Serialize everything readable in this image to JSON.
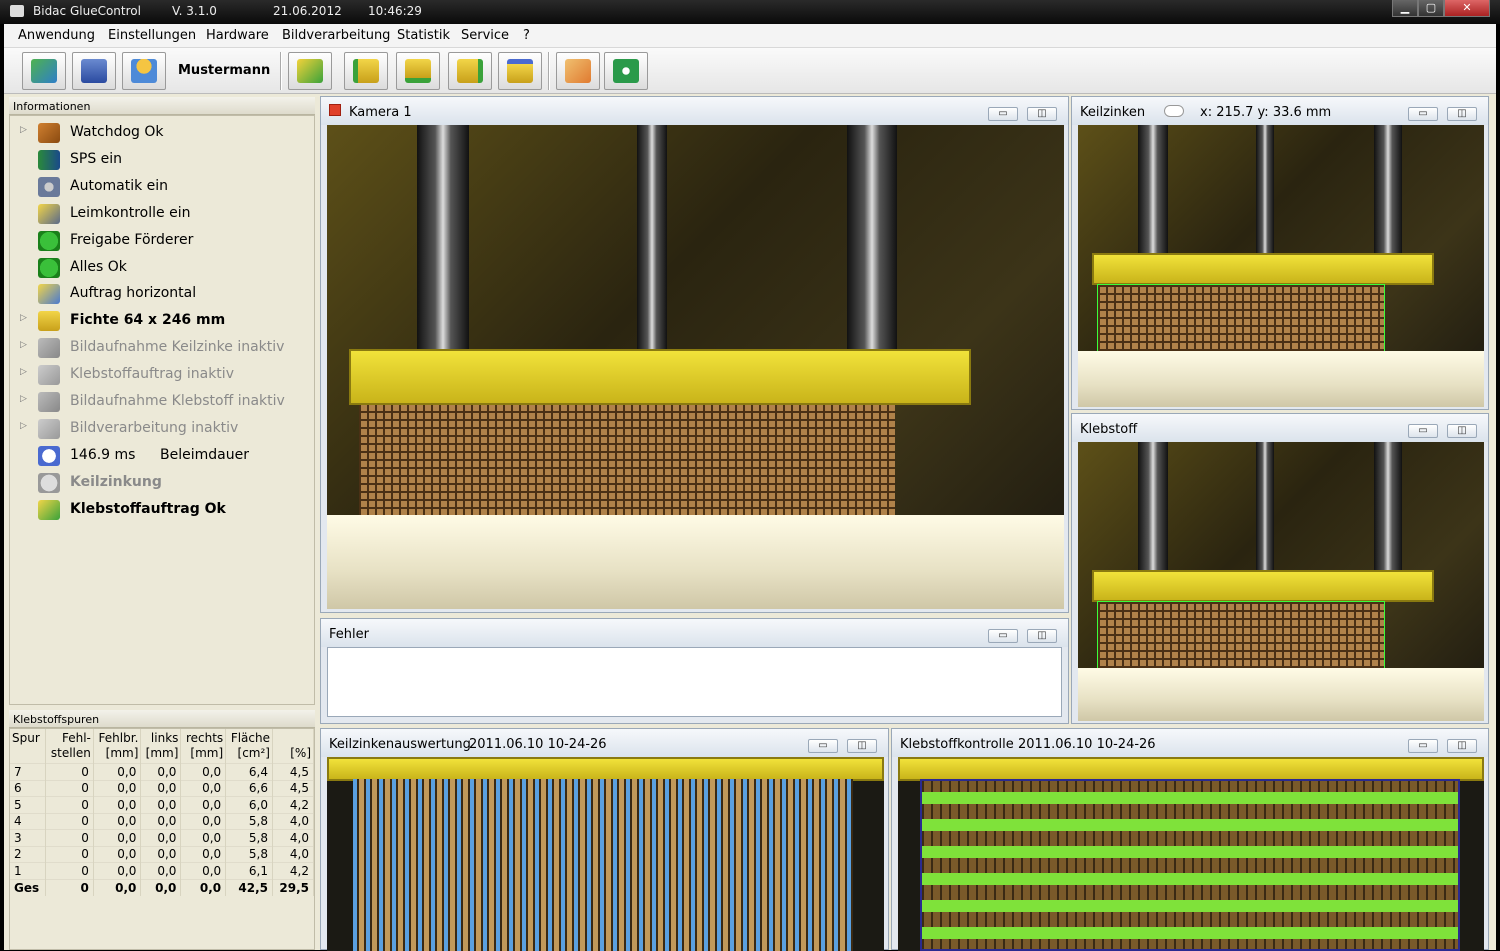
{
  "titlebar": {
    "app": "Bidac GlueControl",
    "version": "V. 3.1.0",
    "date": "21.06.2012",
    "time": "10:46:29"
  },
  "menu": [
    "Anwendung",
    "Einstellungen",
    "Hardware",
    "Bildverarbeitung",
    "Statistik",
    "Service",
    "?"
  ],
  "toolbar": {
    "user": "Mustermann",
    "icons": [
      "exit-icon",
      "save-icon",
      "user-icon",
      "edit-icon",
      "load-icon-1",
      "load-icon-2",
      "load-icon-3",
      "save-icon-2",
      "touch-icon",
      "camera-settings-icon"
    ]
  },
  "info_panel": {
    "title": "Informationen",
    "items": [
      {
        "label": "Watchdog Ok",
        "icon": "watchdog-icon",
        "arrow": true,
        "state": "normal"
      },
      {
        "label": "SPS ein",
        "icon": "sps-icon",
        "arrow": false,
        "state": "normal"
      },
      {
        "label": "Automatik ein",
        "icon": "gears-icon",
        "arrow": false,
        "state": "normal"
      },
      {
        "label": "Leimkontrolle ein",
        "icon": "glue-control-icon",
        "arrow": false,
        "state": "normal"
      },
      {
        "label": "Freigabe Förderer",
        "icon": "green-arrow-icon",
        "arrow": false,
        "state": "normal"
      },
      {
        "label": "Alles Ok",
        "icon": "green-check-icon",
        "arrow": false,
        "state": "normal"
      },
      {
        "label": "Auftrag horizontal",
        "icon": "horizontal-icon",
        "arrow": false,
        "state": "normal"
      },
      {
        "label": "Fichte 64 x 246 mm",
        "icon": "wood-icon",
        "arrow": true,
        "state": "bold"
      },
      {
        "label": "Bildaufnahme Keilzinke inaktiv",
        "icon": "camera-gray-icon",
        "arrow": true,
        "state": "inactive"
      },
      {
        "label": "Klebstoffauftrag inaktiv",
        "icon": "glue-gray-icon",
        "arrow": true,
        "state": "inactive"
      },
      {
        "label": "Bildaufnahme Klebstoff inaktiv",
        "icon": "camera-gray-icon-2",
        "arrow": true,
        "state": "inactive"
      },
      {
        "label": "Bildverarbeitung inaktiv",
        "icon": "processing-gray-icon",
        "arrow": true,
        "state": "inactive"
      },
      {
        "label": "146.9 ms",
        "extra": "Beleimdauer",
        "icon": "stopwatch-icon",
        "arrow": false,
        "state": "normal"
      },
      {
        "label": "Keilzinkung",
        "icon": "gray-x-icon",
        "arrow": false,
        "state": "inactive-bold"
      },
      {
        "label": "Klebstoffauftrag Ok",
        "icon": "glue-ok-icon",
        "arrow": false,
        "state": "bold"
      }
    ]
  },
  "klebstoffspuren": {
    "title": "Klebstoffspuren",
    "headers": [
      [
        "Spur",
        ""
      ],
      [
        "Fehl-",
        "stellen"
      ],
      [
        "Fehlbr.",
        "[mm]"
      ],
      [
        "links",
        "[mm]"
      ],
      [
        "rechts",
        "[mm]"
      ],
      [
        "Fläche",
        "[cm²]"
      ],
      [
        "",
        "[%]"
      ]
    ],
    "rows": [
      [
        "7",
        "0",
        "0,0",
        "0,0",
        "0,0",
        "6,4",
        "4,5"
      ],
      [
        "6",
        "0",
        "0,0",
        "0,0",
        "0,0",
        "6,6",
        "4,5"
      ],
      [
        "5",
        "0",
        "0,0",
        "0,0",
        "0,0",
        "6,0",
        "4,2"
      ],
      [
        "4",
        "0",
        "0,0",
        "0,0",
        "0,0",
        "5,8",
        "4,0"
      ],
      [
        "3",
        "0",
        "0,0",
        "0,0",
        "0,0",
        "5,8",
        "4,0"
      ],
      [
        "2",
        "0",
        "0,0",
        "0,0",
        "0,0",
        "5,8",
        "4,0"
      ],
      [
        "1",
        "0",
        "0,0",
        "0,0",
        "0,0",
        "6,1",
        "4,2"
      ]
    ],
    "total": [
      "Ges",
      "0",
      "0,0",
      "0,0",
      "0,0",
      "42,5",
      "29,5"
    ]
  },
  "windows": {
    "kamera1": {
      "title": "Kamera 1"
    },
    "keilzinken": {
      "title": "Keilzinken",
      "coords": "x: 215.7   y: 33.6 mm"
    },
    "klebstoff": {
      "title": "Klebstoff"
    },
    "fehler": {
      "title": "Fehler"
    },
    "keilzinkenauswertung": {
      "title": "Keilzinkenauswertung",
      "timestamp": "2011.06.10 10-24-26"
    },
    "klebstoffkontrolle": {
      "title": "Klebstoffkontrolle",
      "timestamp": "2011.06.10 10-24-26"
    }
  },
  "window_buttons": {
    "minimize": "▭",
    "restore": "◫"
  },
  "colors": {
    "beam": "#e6d52a",
    "glue": "#7fe23a",
    "fingers": "#5aa0e0",
    "accent_red": "#e0402a"
  }
}
